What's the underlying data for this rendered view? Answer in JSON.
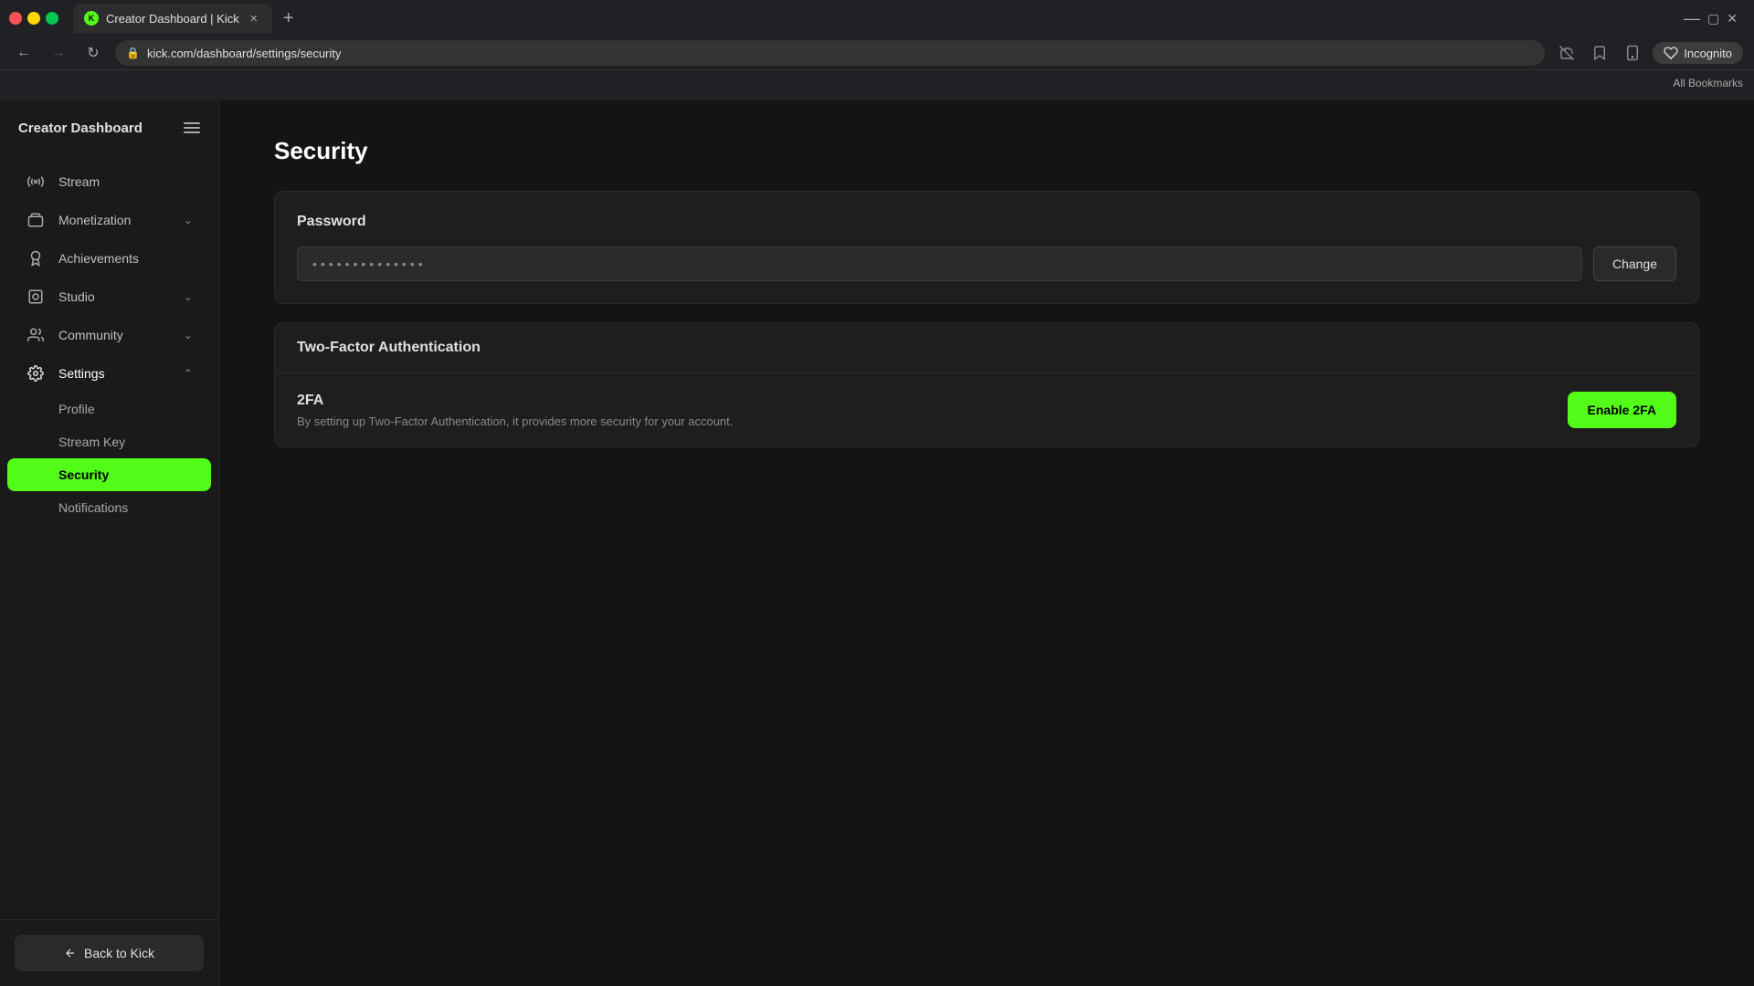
{
  "browser": {
    "tab_title": "Creator Dashboard | Kick",
    "favicon_letter": "K",
    "url": "kick.com/dashboard/settings/security",
    "incognito_label": "Incognito",
    "bookmarks_label": "All Bookmarks"
  },
  "sidebar": {
    "title": "Creator Dashboard",
    "nav_items": [
      {
        "id": "stream",
        "label": "Stream",
        "icon": "stream",
        "has_arrow": false,
        "active": false
      },
      {
        "id": "monetization",
        "label": "Monetization",
        "icon": "monetization",
        "has_arrow": true,
        "active": false
      },
      {
        "id": "achievements",
        "label": "Achievements",
        "icon": "achievements",
        "has_arrow": false,
        "active": false
      },
      {
        "id": "studio",
        "label": "Studio",
        "icon": "studio",
        "has_arrow": true,
        "active": false
      },
      {
        "id": "community",
        "label": "Community",
        "icon": "community",
        "has_arrow": true,
        "active": false
      },
      {
        "id": "settings",
        "label": "Settings",
        "icon": "settings",
        "has_arrow": true,
        "active": true,
        "expanded": true
      }
    ],
    "settings_sub_items": [
      {
        "id": "profile",
        "label": "Profile",
        "active": false
      },
      {
        "id": "stream-key",
        "label": "Stream Key",
        "active": false
      },
      {
        "id": "security",
        "label": "Security",
        "active": true
      },
      {
        "id": "notifications",
        "label": "Notifications",
        "active": false
      }
    ],
    "back_to_kick_label": "Back to Kick"
  },
  "main": {
    "page_title": "Security",
    "password_section": {
      "title": "Password",
      "input_placeholder": "••••••••••••••",
      "change_button_label": "Change"
    },
    "two_fa_section": {
      "title": "Two-Factor Authentication",
      "fa_label": "2FA",
      "fa_description": "By setting up Two-Factor Authentication, it provides more security for your account.",
      "enable_button_label": "Enable 2FA"
    }
  },
  "colors": {
    "accent": "#53fc18",
    "bg_dark": "#141414",
    "bg_sidebar": "#1a1a1a",
    "bg_card": "#1e1e1e",
    "border": "#2a2a2a"
  }
}
